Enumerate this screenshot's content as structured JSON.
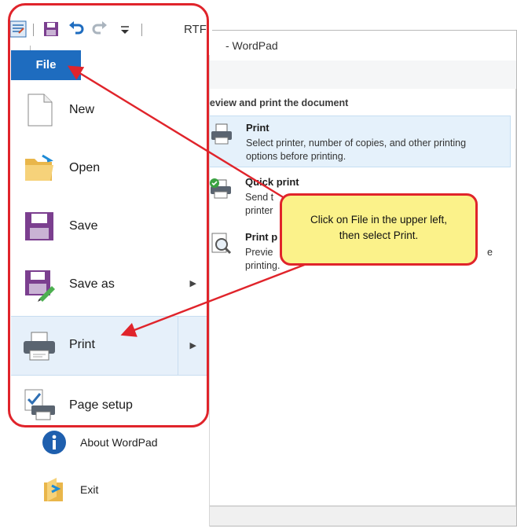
{
  "window": {
    "title": "- WordPad"
  },
  "quick_access": {
    "format_label": "RTF"
  },
  "file_tab": {
    "label": "File"
  },
  "menu": {
    "items": [
      {
        "label": "New",
        "icon": "new-document-icon"
      },
      {
        "label": "Open",
        "icon": "open-folder-icon"
      },
      {
        "label": "Save",
        "icon": "save-disk-icon"
      },
      {
        "label": "Save as",
        "icon": "save-as-icon",
        "has_submenu": true
      },
      {
        "label": "Print",
        "icon": "printer-icon",
        "has_submenu": true
      },
      {
        "label": "Page setup",
        "icon": "page-setup-icon"
      },
      {
        "label": "About WordPad",
        "icon": "info-icon"
      },
      {
        "label": "Exit",
        "icon": "exit-icon"
      }
    ]
  },
  "submenu": {
    "header": "review and print the document",
    "options": [
      {
        "title": "Print",
        "desc": "Select printer, number of copies, and other printing options before printing."
      },
      {
        "title": "Quick print",
        "desc_visible": [
          "Send t",
          "printer"
        ]
      },
      {
        "title": "Print p",
        "desc_visible": [
          "Previe",
          "printing.",
          "e"
        ]
      }
    ]
  },
  "callout": {
    "line1": "Click on File in the upper left,",
    "line2": "then select Print."
  },
  "colors": {
    "file_tab": "#1e6cbf",
    "annotation_red": "#e0242b",
    "callout_fill": "#fbf28a",
    "highlight": "#e6f0fa"
  }
}
